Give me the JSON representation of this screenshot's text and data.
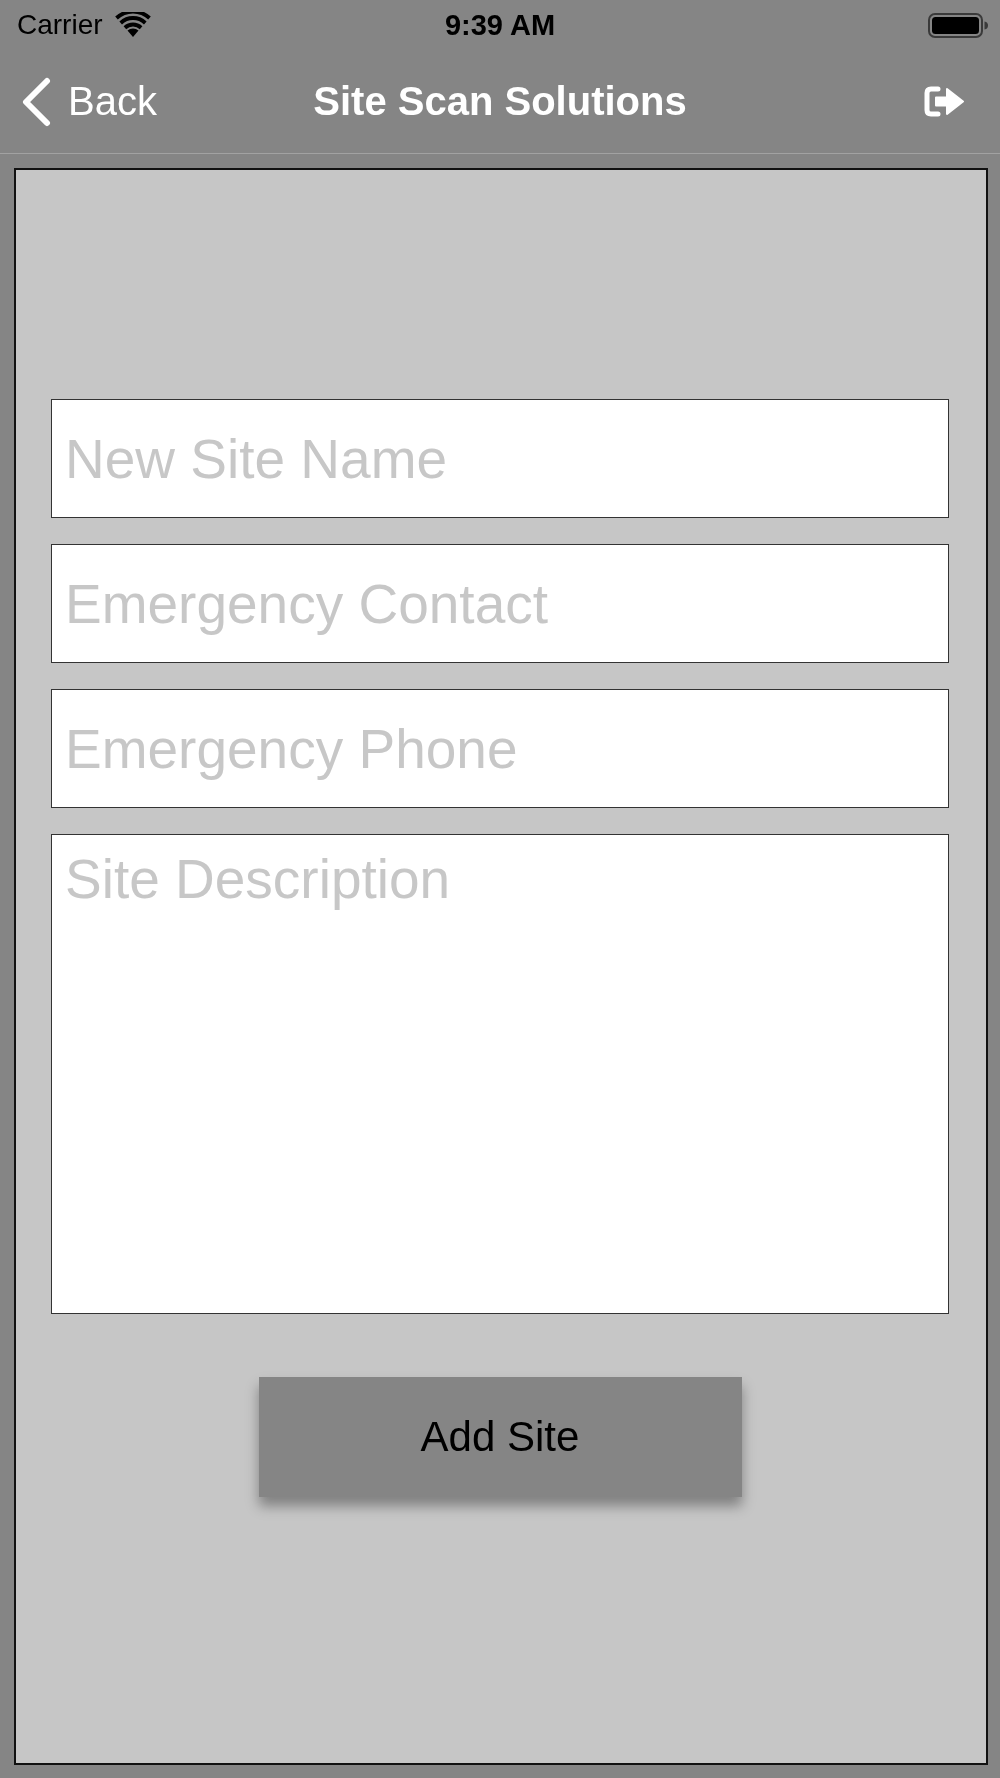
{
  "status_bar": {
    "carrier": "Carrier",
    "time": "9:39 AM"
  },
  "nav_bar": {
    "back_label": "Back",
    "title": "Site Scan Solutions"
  },
  "form": {
    "fields": [
      {
        "kind": "text",
        "placeholder": "New Site Name"
      },
      {
        "kind": "text",
        "placeholder": "Emergency Contact"
      },
      {
        "kind": "text",
        "placeholder": "Emergency Phone"
      },
      {
        "kind": "multiline",
        "placeholder": "Site Description"
      }
    ],
    "submit_button": "Add Site"
  }
}
